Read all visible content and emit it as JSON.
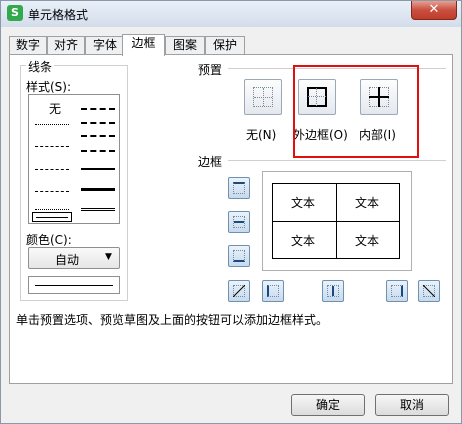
{
  "window": {
    "title": "单元格格式",
    "app_icon_letter": "S",
    "close_glyph": "✕"
  },
  "tabs": [
    {
      "label": "数字"
    },
    {
      "label": "对齐"
    },
    {
      "label": "字体"
    },
    {
      "label": "边框"
    },
    {
      "label": "图案"
    },
    {
      "label": "保护"
    }
  ],
  "active_tab": "边框",
  "line_section": {
    "title": "线条",
    "style_label": "样式(S):",
    "none_label": "无",
    "color_label": "颜色(C):",
    "color_value": "自动",
    "dropdown_glyph": "▼"
  },
  "preset_section": {
    "title": "预置",
    "none_label": "无(N)",
    "outline_label": "外边框(O)",
    "inside_label": "内部(I)"
  },
  "border_section": {
    "title": "边框",
    "preview_cells": [
      "文本",
      "文本",
      "文本",
      "文本"
    ]
  },
  "hint": "单击预置选项、预览草图及上面的按钮可以添加边框样式。",
  "buttons": {
    "ok": "确定",
    "cancel": "取消"
  },
  "colors": {
    "highlight": "#e01010",
    "app_icon": "#33a94d",
    "close": "#c23a28"
  }
}
